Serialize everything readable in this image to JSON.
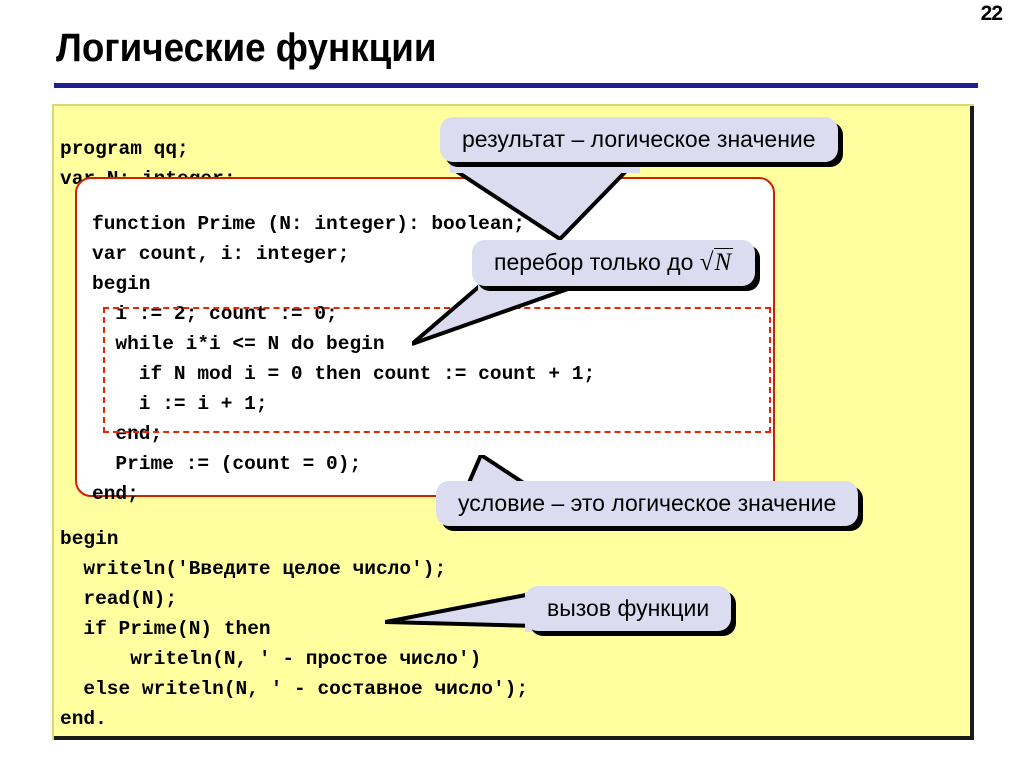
{
  "slide": {
    "number": "22",
    "title": "Логические функции",
    "accent_rule_color": "#1f1f8f",
    "panel_background": "#ffffa0",
    "callout_background": "#dcdcf0",
    "function_box_border": "#cc2200",
    "loop_box_border": "#ee2200"
  },
  "code": {
    "top": "program qq;\nvar N: integer;",
    "function": "function Prime (N: integer): boolean;\nvar count, i: integer;\nbegin\n  i := 2; count := 0;\n  while i*i <= N do begin\n    if N mod i = 0 then count := count + 1;\n    i := i + 1;\n  end;\n  Prime := (count = 0);\nend;",
    "bottom": "begin\n  writeln('Введите целое число');\n  read(N);\n  if Prime(N) then\n      writeln(N, ' - простое число')\n  else writeln(N, ' - составное число');\nend."
  },
  "callouts": {
    "result": "результат – логическое значение",
    "loop_prefix": "перебор только до ",
    "loop_sqrt_radicand": "N",
    "loop_sqrt_sign": "√",
    "condition": "условие – это логическое значение",
    "call": "вызов функции"
  }
}
